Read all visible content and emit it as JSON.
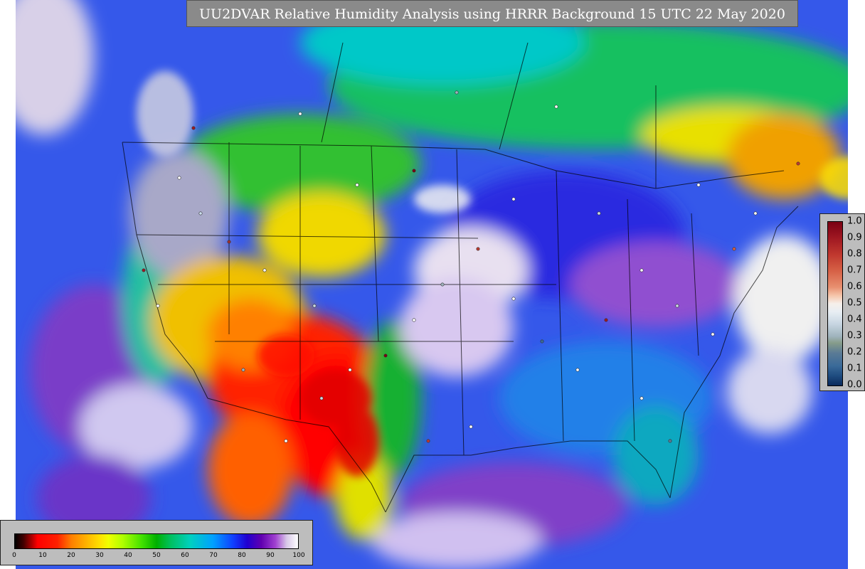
{
  "title": "UU2DVAR Relative Humidity Analysis using HRRR Background 15 UTC 22 May 2020",
  "colorbar_rh": {
    "ticks": [
      "0",
      "10",
      "20",
      "30",
      "40",
      "50",
      "60",
      "70",
      "80",
      "90",
      "100"
    ],
    "values": [
      0,
      10,
      20,
      30,
      40,
      50,
      60,
      70,
      80,
      90,
      100
    ]
  },
  "colorbar_obs": {
    "ticks": [
      "1.0",
      "0.9",
      "0.8",
      "0.7",
      "0.6",
      "0.5",
      "0.4",
      "0.3",
      "0.2",
      "0.1",
      "0.0"
    ],
    "values": [
      1.0,
      0.9,
      0.8,
      0.7,
      0.6,
      0.5,
      0.4,
      0.3,
      0.2,
      0.1,
      0.0
    ]
  },
  "colors": {
    "dry_red": "#ff0000",
    "mid_yellow": "#ffe000",
    "green": "#00b000",
    "moist_blue": "#1040ff",
    "saturated_purple": "#8040c0"
  }
}
